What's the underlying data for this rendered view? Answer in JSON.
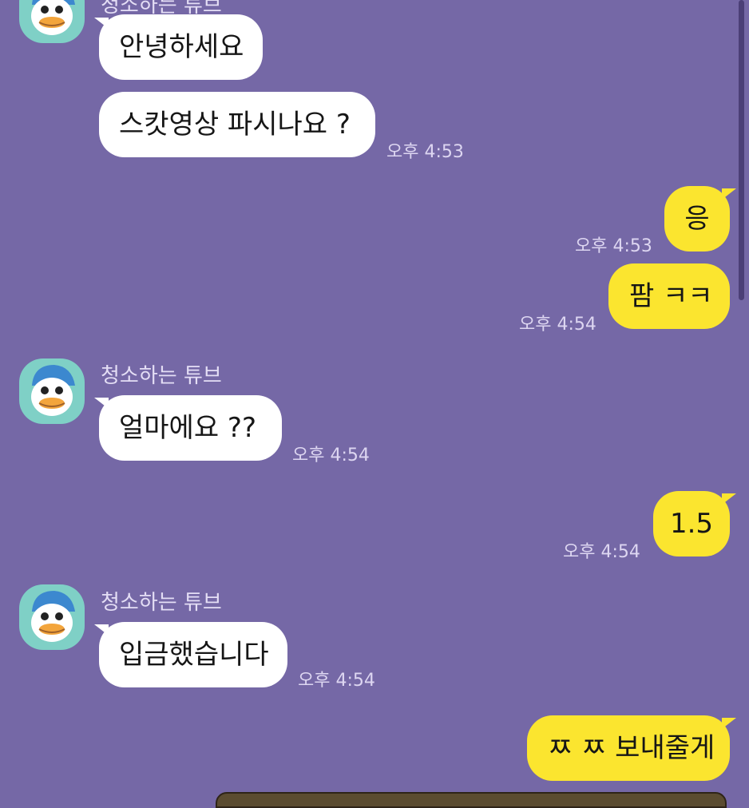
{
  "chat": {
    "partner_name": "청소하는 튜브",
    "colors": {
      "background": "#7568a6",
      "incoming_bubble": "#ffffff",
      "outgoing_bubble": "#fbe52f",
      "avatar_bg": "#7fd0c6"
    },
    "messages": [
      {
        "from": "partner",
        "text": "안녕하세요"
      },
      {
        "from": "partner",
        "text": "스캇영상 파시나요 ?",
        "time": "오후 4:53"
      },
      {
        "from": "me",
        "text": "응",
        "time": "오후 4:53"
      },
      {
        "from": "me",
        "text": "팜 ㅋㅋ",
        "time": "오후 4:54"
      },
      {
        "from": "partner",
        "text": "얼마에요 ??",
        "time": "오후 4:54"
      },
      {
        "from": "me",
        "text": "1.5",
        "time": "오후 4:54"
      },
      {
        "from": "partner",
        "text": "입금했습니다",
        "time": "오후 4:54"
      },
      {
        "from": "me",
        "text": "ㅉ ㅉ 보내줄게"
      }
    ]
  }
}
